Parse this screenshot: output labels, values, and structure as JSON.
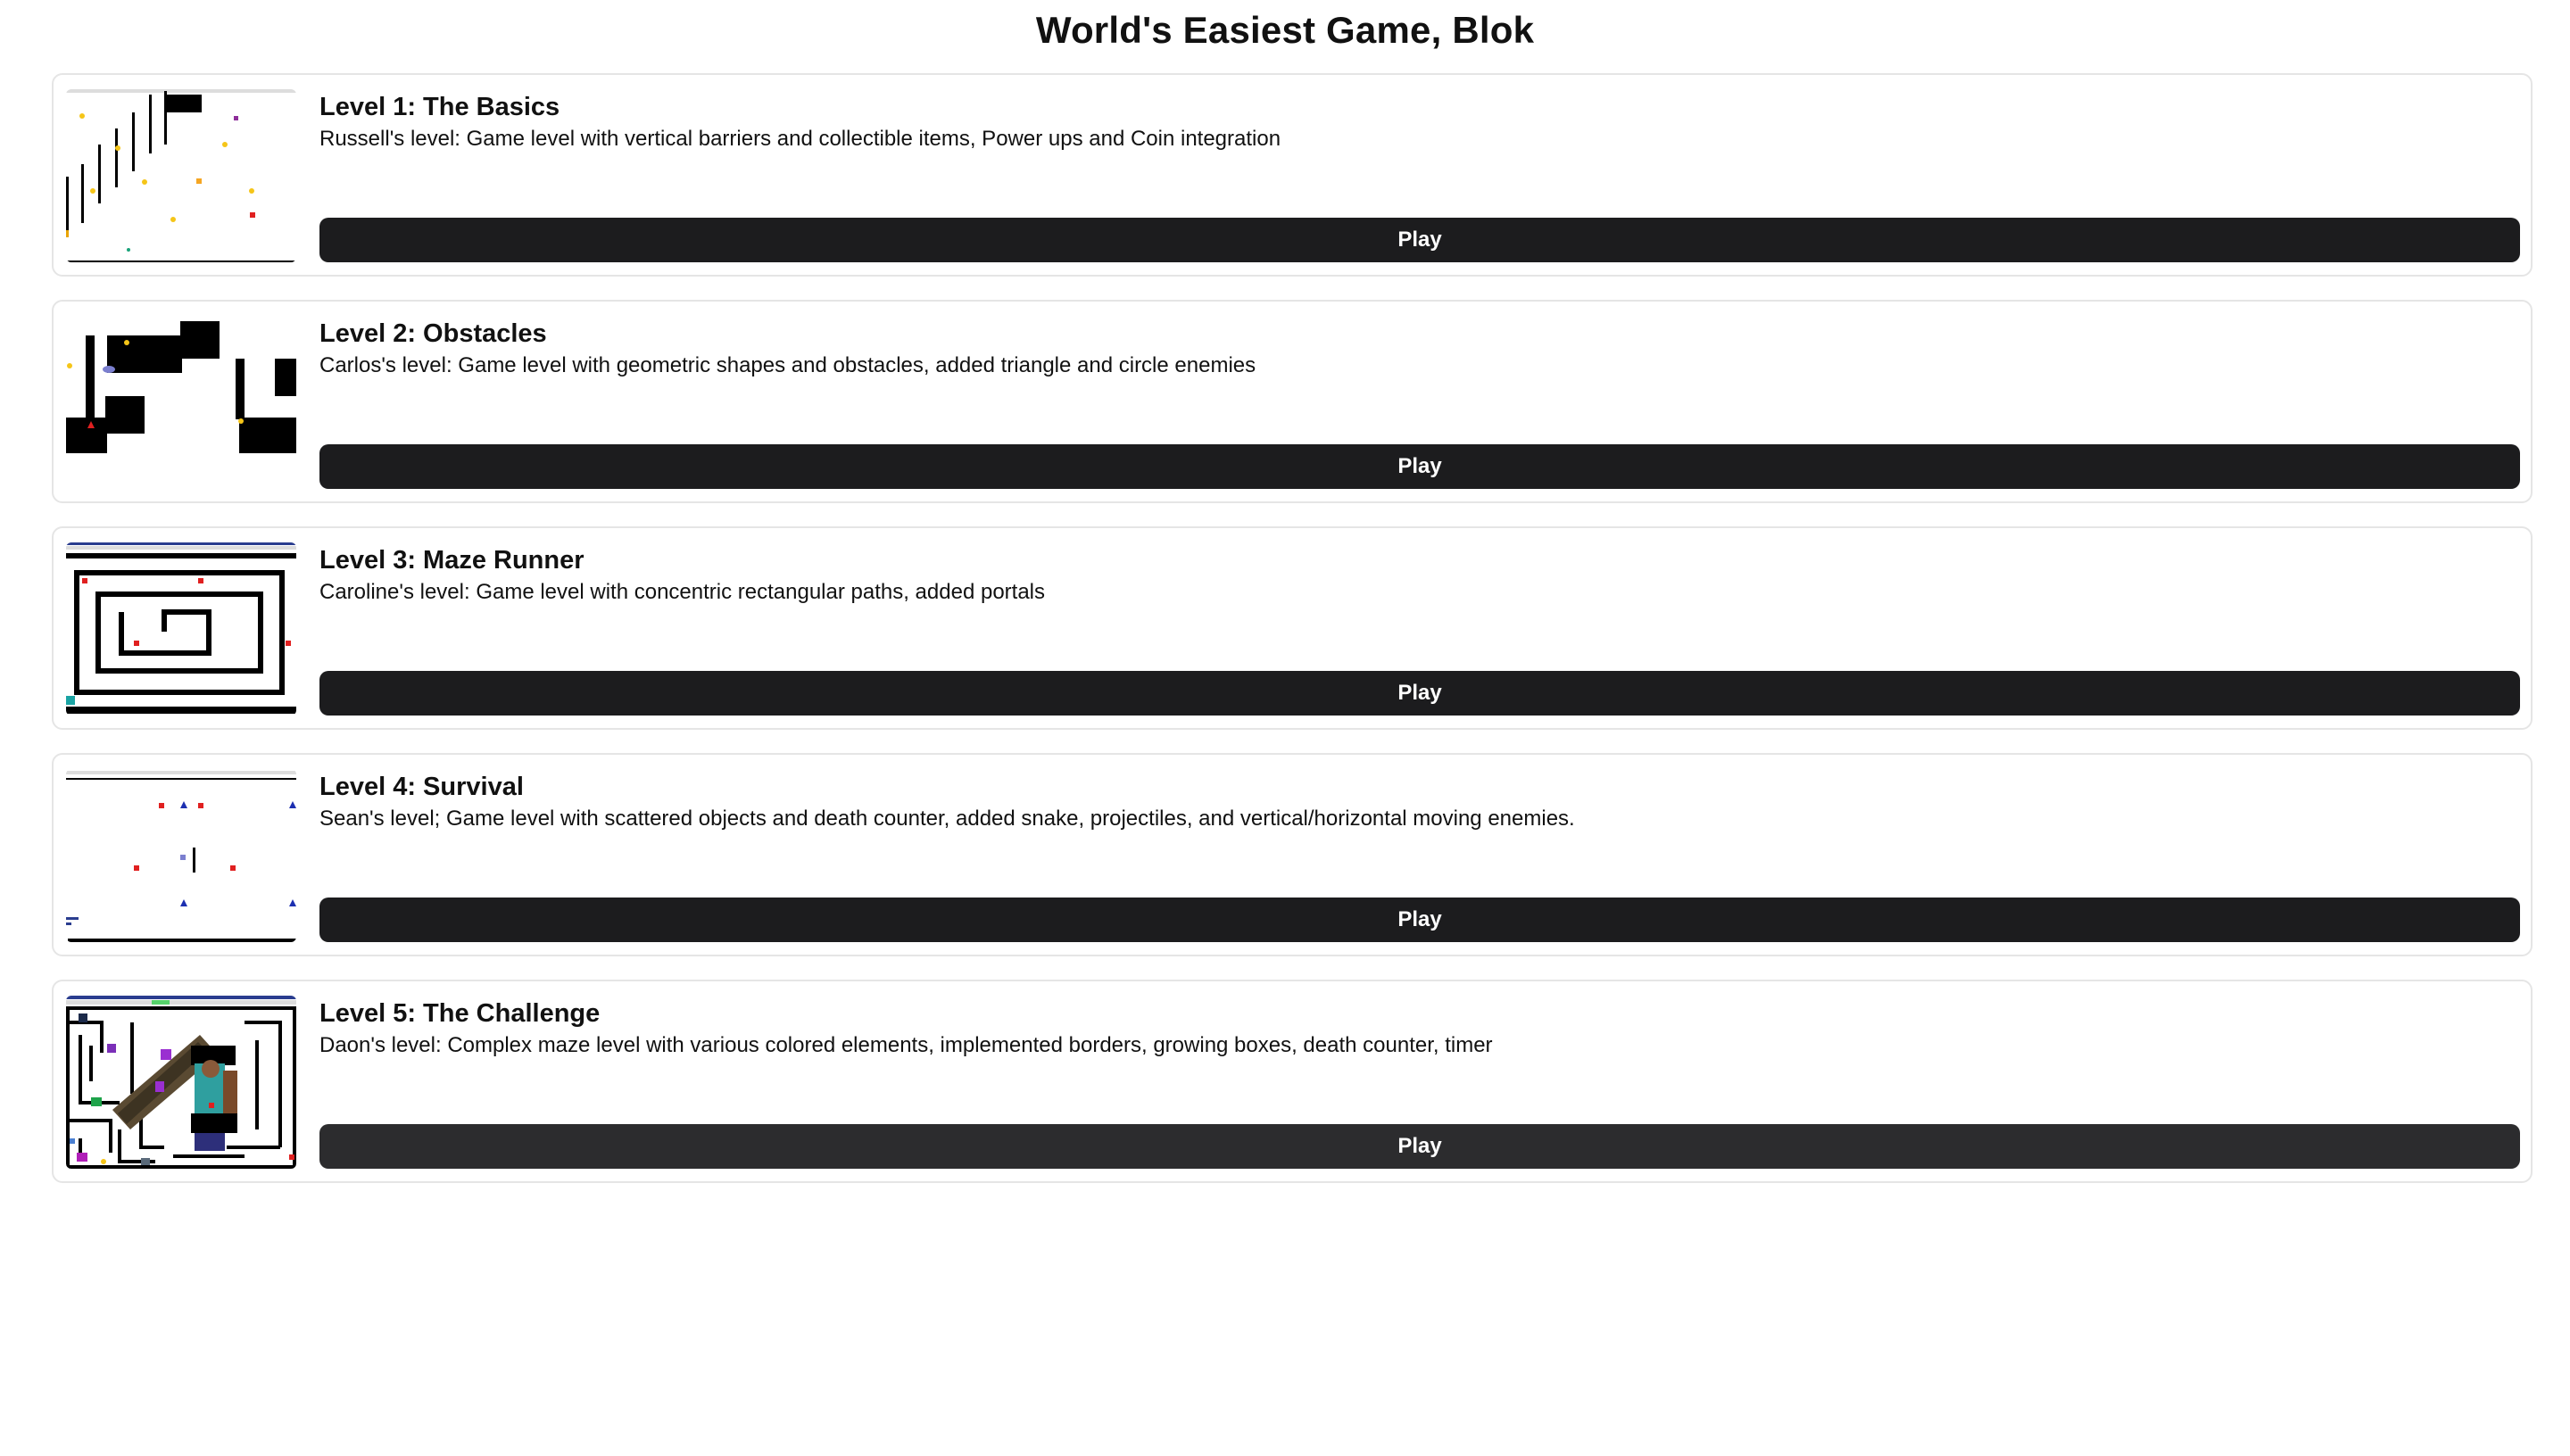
{
  "page": {
    "title": "World's Easiest Game, Blok"
  },
  "levels": [
    {
      "title": "Level 1: The Basics",
      "description": "Russell's level: Game level with vertical barriers and collectible items, Power ups and Coin integration",
      "play_label": "Play"
    },
    {
      "title": "Level 2: Obstacles",
      "description": "Carlos's level: Game level with geometric shapes and obstacles, added triangle and circle enemies",
      "play_label": "Play"
    },
    {
      "title": "Level 3: Maze Runner",
      "description": "Caroline's level: Game level with concentric rectangular paths, added portals",
      "play_label": "Play"
    },
    {
      "title": "Level 4: Survival",
      "description": "Sean's level; Game level with scattered objects and death counter, added snake, projectiles, and vertical/horizontal moving enemies.",
      "play_label": "Play"
    },
    {
      "title": "Level 5: The Challenge",
      "description": "Daon's level: Complex maze level with various colored elements, implemented borders, growing boxes, death counter, timer",
      "play_label": "Play"
    }
  ],
  "colors": {
    "play_button": "#1c1c1e",
    "play_button_hover": "#2c2c2e",
    "card_border": "#e5e5e5"
  }
}
